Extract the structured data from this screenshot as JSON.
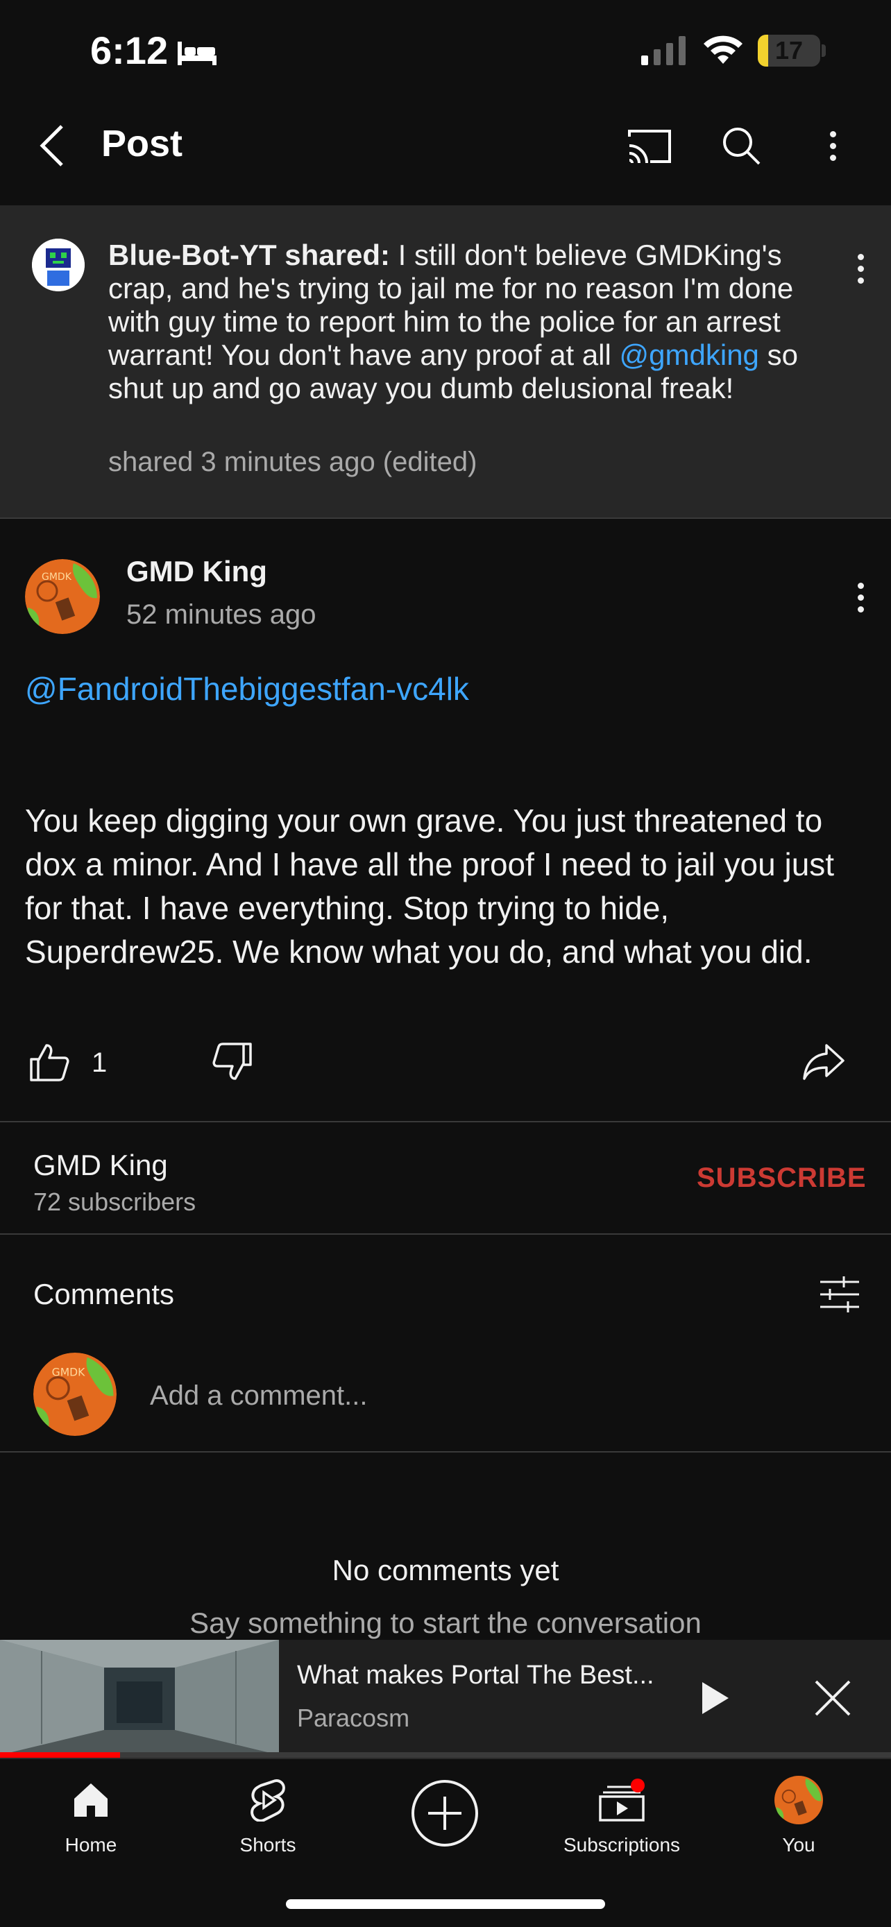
{
  "status": {
    "time": "6:12",
    "battery": "17",
    "battery_level": 0.17
  },
  "header": {
    "title": "Post"
  },
  "shared_post": {
    "author": "Blue-Bot-YT shared:",
    "text_before": " I still don't believe GMDKing's crap, and he's trying to jail me for no reason I'm done with guy time to report him to the police for an arrest warrant! You don't have any proof at all ",
    "mention": "@gmdking",
    "text_after": " so shut up and go away you dumb delusional freak!",
    "meta": "shared 3 minutes ago (edited)"
  },
  "post": {
    "author": "GMD King",
    "time": "52 minutes ago",
    "mention": "@FandroidThebiggestfan-vc4lk",
    "body": "You keep digging your own grave. You just threatened to dox a minor. And I have all the proof I need to jail you just for that. I have everything. Stop trying to hide, Superdrew25. We know what you do, and what you did.",
    "likes": "1"
  },
  "channel": {
    "name": "GMD King",
    "subscribers": "72 subscribers",
    "subscribe_label": "SUBSCRIBE"
  },
  "comments": {
    "title": "Comments",
    "placeholder": "Add a comment...",
    "empty_title": "No comments yet",
    "empty_subtitle": "Say something to start the conversation"
  },
  "mini_player": {
    "title": "What makes Portal The Best...",
    "channel": "Paracosm",
    "progress": 0.135
  },
  "nav": {
    "items": [
      {
        "label": "Home",
        "icon": "home-icon"
      },
      {
        "label": "Shorts",
        "icon": "shorts-icon"
      },
      {
        "label": "",
        "icon": "create-icon"
      },
      {
        "label": "Subscriptions",
        "icon": "subscriptions-icon"
      },
      {
        "label": "You",
        "icon": "avatar"
      }
    ]
  },
  "colors": {
    "accent_link": "#3ea6ff",
    "subscribe": "#cc3a33",
    "background": "#0f0f0f",
    "card": "#272727"
  }
}
